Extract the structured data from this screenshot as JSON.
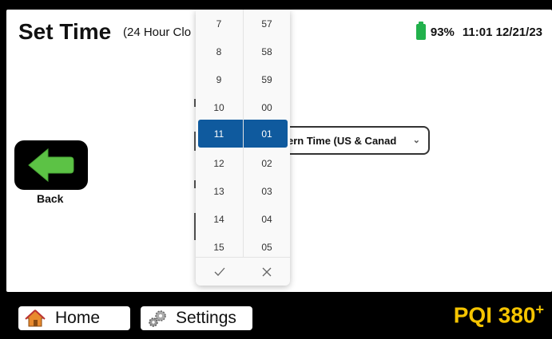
{
  "header": {
    "title": "Set Time",
    "subtitle": "(24 Hour Clo",
    "battery_percent": "93%",
    "datetime": "11:01 12/21/23",
    "battery_color": "#22b14c"
  },
  "back": {
    "label": "Back",
    "arrow_color": "#5cc245"
  },
  "timezone": {
    "value": "ern Time (US & Canad",
    "chevron": "chevron-down-icon"
  },
  "time_picker": {
    "hours": [
      "7",
      "8",
      "9",
      "10",
      "11",
      "12",
      "13",
      "14",
      "15"
    ],
    "minutes": [
      "57",
      "58",
      "59",
      "00",
      "01",
      "02",
      "03",
      "04",
      "05"
    ],
    "selected_hour": "11",
    "selected_minute": "01",
    "confirm_icon": "check-icon",
    "cancel_icon": "close-icon",
    "selected_color": "#0f5a9e"
  },
  "footer": {
    "home_label": "Home",
    "settings_label": "Settings",
    "brand": "PQI 380",
    "brand_sup": "+",
    "brand_color": "#f5c400"
  }
}
